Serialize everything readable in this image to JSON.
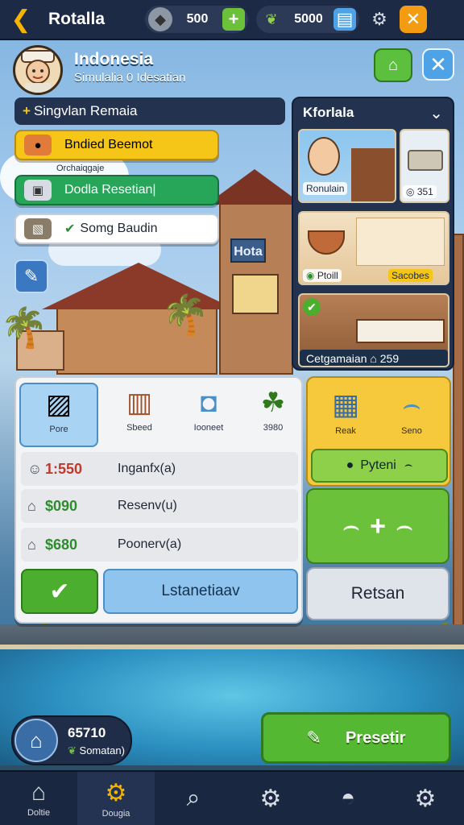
{
  "topbar": {
    "title": "Rotalla",
    "stone_amount": "500",
    "leaf_amount": "5000"
  },
  "header": {
    "title": "Indonesia",
    "subtitle": "Simulalia 0 Idesatian"
  },
  "quests": {
    "header": "Singvlan Remaia",
    "items": [
      {
        "label": "Bndied Beemot",
        "color": "#f5c518"
      },
      {
        "label": "Dodla Resetian|",
        "color": "#27a65a"
      },
      {
        "label": "Somg Baudin",
        "color": "#ffffff"
      }
    ],
    "sub_label": "Orchaiqgaje"
  },
  "rooms": {
    "header": "Kforlala",
    "tiles": [
      {
        "label": "Ronulain"
      },
      {
        "label": "351"
      },
      {
        "label": "Ptoill"
      },
      {
        "label": "Sacobes"
      },
      {
        "label": "Cetgamaian"
      },
      {
        "label": "259"
      }
    ]
  },
  "build": {
    "categories": [
      {
        "label": "Pore"
      },
      {
        "label": "Sbeed"
      },
      {
        "label": "Iooneet"
      },
      {
        "label": "3980"
      }
    ],
    "rows": [
      {
        "value": "1:550",
        "label": "Inganfx(a)",
        "color": "#c0392b"
      },
      {
        "value": "$090",
        "label": "Resenv(u)",
        "color": "#2e8b2e"
      },
      {
        "value": "$680",
        "label": "Poonerv(a)",
        "color": "#2e8b2e"
      }
    ],
    "install_label": "Lstanetiaav"
  },
  "side": {
    "cat_a": "Reak",
    "cat_b": "Seno",
    "pick_label": "Pyteni",
    "return_label": "Retsan"
  },
  "footer": {
    "stat_value": "65710",
    "stat_label": "Somatan)",
    "stat_icon_label": "Eiinb",
    "preset_label": "Presetir"
  },
  "nav": {
    "items": [
      {
        "label": "Doltie"
      },
      {
        "label": "Dougia"
      },
      {
        "label": ""
      },
      {
        "label": ""
      },
      {
        "label": ""
      },
      {
        "label": ""
      }
    ]
  }
}
